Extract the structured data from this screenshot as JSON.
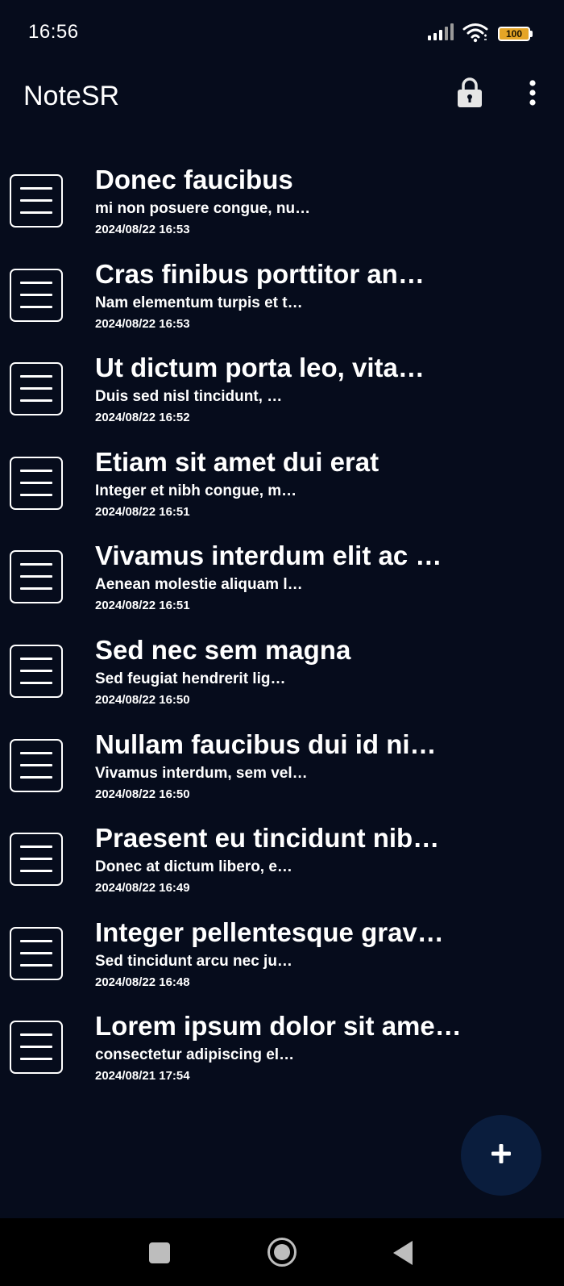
{
  "status_bar": {
    "time": "16:56",
    "battery_level": "100",
    "icons": [
      "signal-icon",
      "wifi-icon",
      "battery-icon"
    ],
    "battery_color": "#e5a526"
  },
  "app_bar": {
    "title": "NoteSR",
    "actions": [
      "lock-icon",
      "more-vert-icon"
    ]
  },
  "notes": [
    {
      "title": "Donec faucibus",
      "preview": "mi non posuere congue, nu…",
      "date": "2024/08/22 16:53"
    },
    {
      "title": "Cras finibus porttitor an…",
      "preview": "Nam elementum turpis et t…",
      "date": "2024/08/22 16:53"
    },
    {
      "title": "Ut dictum porta leo, vita…",
      "preview": "Duis sed nisl tincidunt, …",
      "date": "2024/08/22 16:52"
    },
    {
      "title": "Etiam sit amet dui erat",
      "preview": "Integer et nibh congue, m…",
      "date": "2024/08/22 16:51"
    },
    {
      "title": "Vivamus interdum elit ac …",
      "preview": "Aenean molestie aliquam l…",
      "date": "2024/08/22 16:51"
    },
    {
      "title": "Sed nec sem magna",
      "preview": "Sed feugiat hendrerit lig…",
      "date": "2024/08/22 16:50"
    },
    {
      "title": "Nullam faucibus dui id ni…",
      "preview": "Vivamus interdum, sem vel…",
      "date": "2024/08/22 16:50"
    },
    {
      "title": "Praesent eu tincidunt nib…",
      "preview": "Donec at dictum libero, e…",
      "date": "2024/08/22 16:49"
    },
    {
      "title": "Integer pellentesque grav…",
      "preview": "Sed tincidunt arcu nec ju…",
      "date": "2024/08/22 16:48"
    },
    {
      "title": "Lorem ipsum dolor sit ame…",
      "preview": "consectetur adipiscing el…",
      "date": "2024/08/21 17:54"
    }
  ],
  "fab": {
    "icon": "plus-icon",
    "color": "#0a1d3d"
  },
  "nav_bar": {
    "icons": [
      "recent-apps-icon",
      "home-icon",
      "back-icon"
    ]
  },
  "colors": {
    "background": "#060c1c",
    "text": "#ffffff"
  }
}
